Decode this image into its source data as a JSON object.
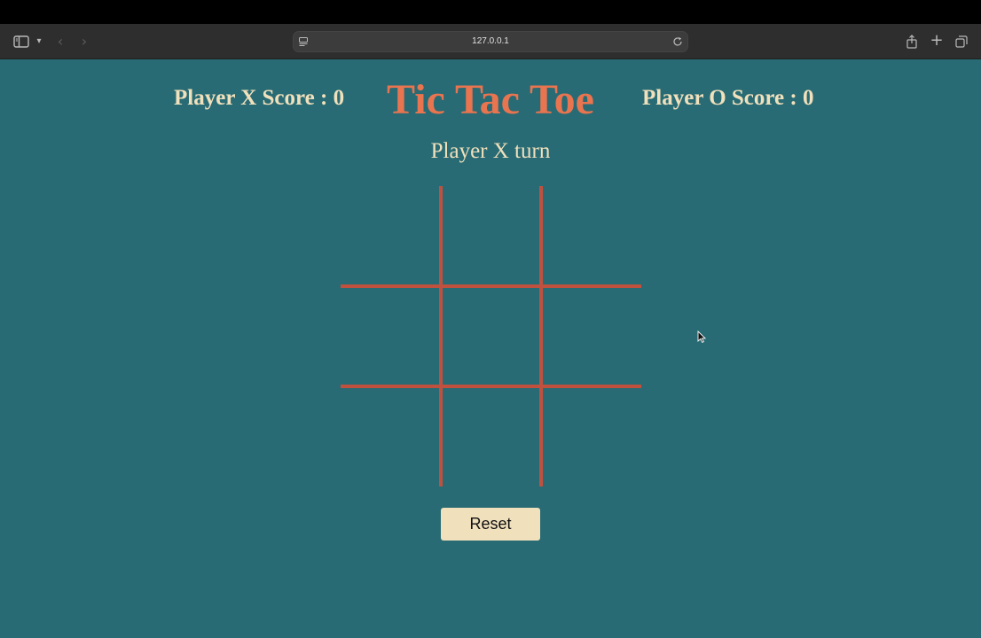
{
  "browser": {
    "url": "127.0.0.1"
  },
  "game": {
    "title": "Tic Tac Toe",
    "score_x_label": "Player X Score : 0",
    "score_o_label": "Player O Score : 0",
    "turn_status": "Player X turn",
    "board": [
      "",
      "",
      "",
      "",
      "",
      "",
      "",
      "",
      ""
    ],
    "reset_label": "Reset"
  },
  "colors": {
    "background": "#286b74",
    "title": "#e97450",
    "text": "#f1e0bc",
    "grid_lines": "#c0513f",
    "button": "#f1e0bc"
  },
  "icons": {
    "sidebar": "sidebar-icon",
    "back": "chevron-left-icon",
    "forward": "chevron-right-icon",
    "reload": "reload-icon",
    "share": "share-icon",
    "new_tab": "plus-icon",
    "tabs": "tabs-overview-icon"
  }
}
